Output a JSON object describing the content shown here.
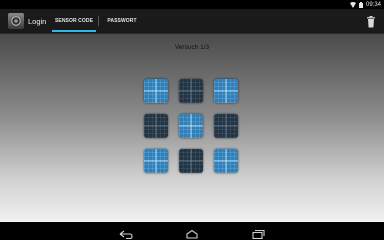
{
  "status_bar": {
    "time": "09:34",
    "icons": [
      "wifi-icon",
      "battery-icon"
    ]
  },
  "action_bar": {
    "title": "Login",
    "tabs": [
      {
        "label": "SENSOR CODE",
        "selected": true
      },
      {
        "label": "PASSWORT",
        "selected": false
      }
    ],
    "accent_color": "#33b5e5",
    "action_icon": "trash-icon"
  },
  "main": {
    "attempt_text": "Versuch 1/3",
    "pattern_grid": {
      "rows": 3,
      "cols": 3,
      "cells": [
        {
          "state": "highlighted"
        },
        {
          "state": "dim"
        },
        {
          "state": "highlighted"
        },
        {
          "state": "dim"
        },
        {
          "state": "highlighted"
        },
        {
          "state": "dim"
        },
        {
          "state": "highlighted"
        },
        {
          "state": "dim"
        },
        {
          "state": "highlighted"
        }
      ]
    }
  },
  "nav_bar": {
    "buttons": [
      "back-icon",
      "home-icon",
      "recent-apps-icon"
    ]
  }
}
